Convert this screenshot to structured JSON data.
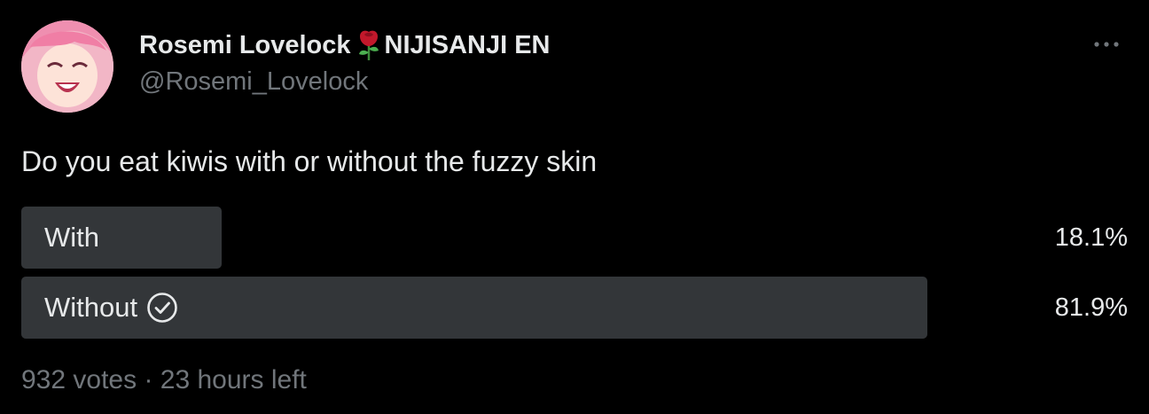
{
  "author": {
    "display_name_main": "Rosemi Lovelock",
    "display_name_suffix": "NIJISANJI EN",
    "name_emoji": "rose-icon",
    "handle": "@Rosemi_Lovelock",
    "avatar": "avatar-image"
  },
  "tweet": {
    "text": "Do you eat kiwis with or without the fuzzy skin"
  },
  "poll": {
    "options": [
      {
        "label": "With",
        "percent_text": "18.1%",
        "percent": 18.1,
        "selected": false
      },
      {
        "label": "Without",
        "percent_text": "81.9%",
        "percent": 81.9,
        "selected": true
      }
    ],
    "votes": "932 votes",
    "separator": "·",
    "time_left": "23 hours left",
    "bar_color": "#333639"
  },
  "colors": {
    "background": "#000000",
    "primary_text": "#e7e9ea",
    "secondary_text": "#71767b"
  },
  "icons": {
    "more": "more-dots-icon",
    "selected_vote": "check-circle-icon"
  }
}
